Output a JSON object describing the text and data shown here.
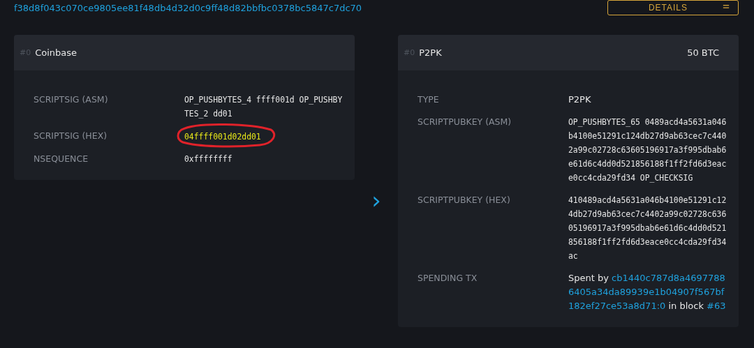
{
  "transaction": {
    "txid": "f38d8f043c070ce9805ee81f48db4d32d0c9ff48d82bbfbc0378bc5847c7dc70",
    "details_button": "DETAILS"
  },
  "inputs": [
    {
      "index": "#0",
      "title": "Coinbase",
      "rows": [
        {
          "label": "SCRIPTSIG (ASM)",
          "value": "OP_PUSHBYTES_4 ffff001d OP_PUSHBYTES_2 dd01",
          "annotated": false
        },
        {
          "label": "SCRIPTSIG (HEX)",
          "value": "04ffff001d02dd01",
          "annotated": true
        },
        {
          "label": "NSEQUENCE",
          "value": "0xffffffff",
          "annotated": false
        }
      ]
    }
  ],
  "flow_arrow": "›",
  "outputs": [
    {
      "index": "#0",
      "title": "P2PK",
      "amount": "50 BTC",
      "rows": [
        {
          "label": "TYPE",
          "value": "P2PK",
          "kind": "plain"
        },
        {
          "label": "SCRIPTPUBKEY (ASM)",
          "value": "OP_PUSHBYTES_65 0489acd4a5631a046b4100e51291c124db27d9ab63cec7c4402a99c02728c63605196917a3f995dbab6e61d6c4dd0d521856188f1ff2fd6d3eace0cc4cda29fd34 OP_CHECKSIG",
          "kind": "mono"
        },
        {
          "label": "SCRIPTPUBKEY (HEX)",
          "value": "410489acd4a5631a046b4100e51291c124db27d9ab63cec7c4402a99c02728c63605196917a3f995dbab6e61d6c4dd0d521856188f1ff2fd6d3eace0cc4cda29fd34ac",
          "kind": "mono"
        },
        {
          "label": "SPENDING TX",
          "kind": "spent",
          "parts": [
            {
              "kind": "text",
              "text": "Spent by "
            },
            {
              "kind": "link",
              "text": "cb1440c787d8a46977886405a34da89939e1b04907f567bf182ef27ce53a8d71:0"
            },
            {
              "kind": "text",
              "text": " in block "
            },
            {
              "kind": "link",
              "text": "#63"
            }
          ]
        }
      ]
    }
  ]
}
